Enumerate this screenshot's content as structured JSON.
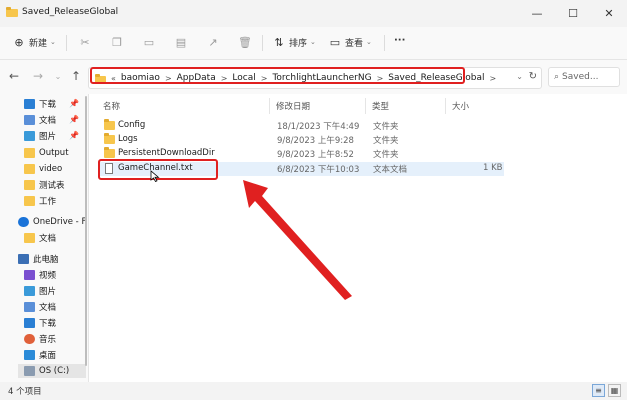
{
  "window": {
    "title": "Saved_ReleaseGlobal"
  },
  "titlebar": {
    "min": "—",
    "max": "☐",
    "close": "✕"
  },
  "toolbar": {
    "new_label": "新建",
    "sort_label": "排序",
    "view_label": "查看",
    "more_label": "···"
  },
  "address": {
    "overflow": "«",
    "crumbs": [
      "baomiao",
      "AppData",
      "Local",
      "TorchlightLauncherNG",
      "Saved_ReleaseGlobal"
    ],
    "chevron": ">"
  },
  "search": {
    "placeholder": "Saved..."
  },
  "sidebar": {
    "items": [
      {
        "label": "下载"
      },
      {
        "label": "文档"
      },
      {
        "label": "图片"
      },
      {
        "label": "Output"
      },
      {
        "label": "video"
      },
      {
        "label": "测试表"
      },
      {
        "label": "工作"
      },
      {
        "label": "OneDrive - F"
      },
      {
        "label": "文档"
      },
      {
        "label": "此电脑"
      },
      {
        "label": "视频"
      },
      {
        "label": "图片"
      },
      {
        "label": "文档"
      },
      {
        "label": "下载"
      },
      {
        "label": "音乐"
      },
      {
        "label": "桌面"
      },
      {
        "label": "OS (C:)"
      }
    ]
  },
  "columns": {
    "name": "名称",
    "date": "修改日期",
    "type": "类型",
    "size": "大小"
  },
  "rows": [
    {
      "name": "Config",
      "date": "18/1/2023 下午4:49",
      "type": "文件夹",
      "size": ""
    },
    {
      "name": "Logs",
      "date": "9/8/2023 上午9:28",
      "type": "文件夹",
      "size": ""
    },
    {
      "name": "PersistentDownloadDir",
      "date": "9/8/2023 上午8:52",
      "type": "文件夹",
      "size": ""
    },
    {
      "name": "GameChannel.txt",
      "date": "6/8/2023 下午10:03",
      "type": "文本文档",
      "size": "1 KB"
    }
  ],
  "status": {
    "count": "4 个项目"
  }
}
